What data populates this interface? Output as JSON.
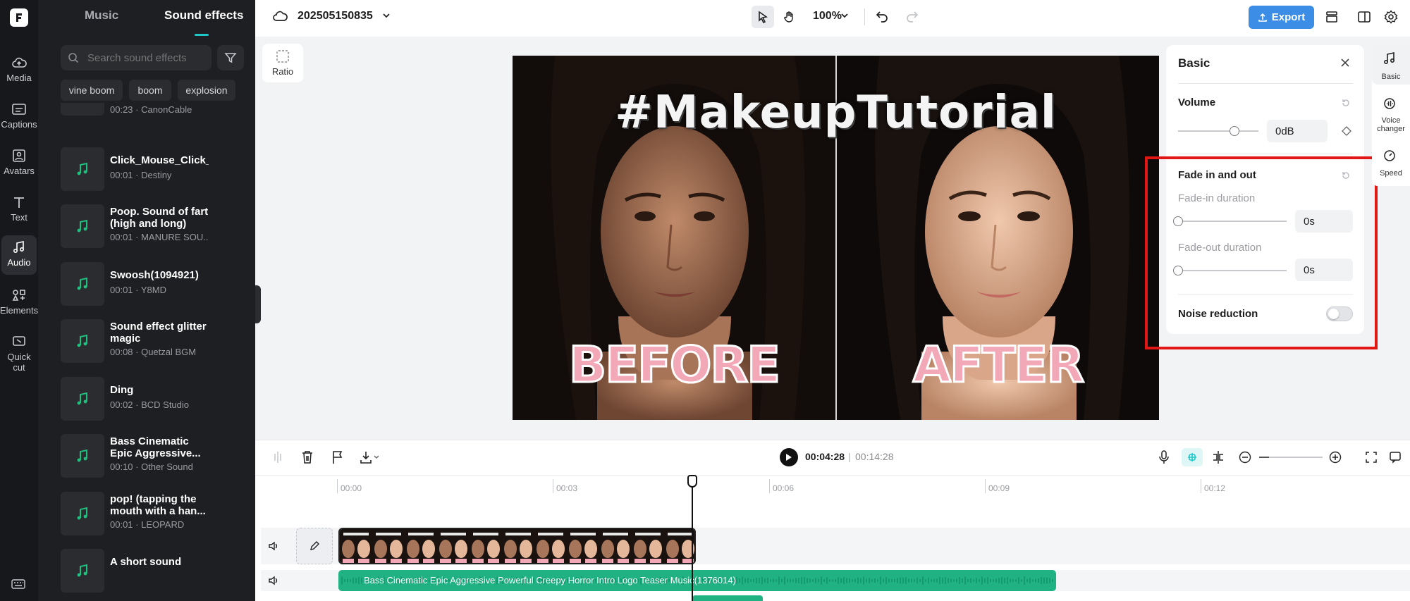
{
  "rail": {
    "items": [
      {
        "label": "Media",
        "icon": "cloud-icon"
      },
      {
        "label": "Captions",
        "icon": "captions-icon"
      },
      {
        "label": "Avatars",
        "icon": "avatar-icon"
      },
      {
        "label": "Text",
        "icon": "text-icon"
      },
      {
        "label": "Audio",
        "icon": "music-note-icon"
      },
      {
        "label": "Elements",
        "icon": "elements-icon"
      },
      {
        "label": "Quick cut",
        "icon": "quick-cut-icon"
      }
    ]
  },
  "library": {
    "tabs": {
      "music": "Music",
      "sound_effects": "Sound effects"
    },
    "search_placeholder": "Search sound effects",
    "chips": [
      "vine boom",
      "boom",
      "explosion"
    ],
    "partial_item_meta": "00:23 · CanonCable",
    "items": [
      {
        "title": "Click_Mouse_Click_",
        "meta": "00:01 · Destiny"
      },
      {
        "title": "Poop. Sound of fart (high and long)",
        "meta": "00:01 · MANURE SOU..."
      },
      {
        "title": "Swoosh(1094921)",
        "meta": "00:01 · Y8MD"
      },
      {
        "title": "Sound effect glitter magic",
        "meta": "00:08 · Quetzal BGM"
      },
      {
        "title": "Ding",
        "meta": "00:02 · BCD Studio"
      },
      {
        "title": "Bass Cinematic Epic Aggressive...",
        "meta": "00:10 · Other Sound"
      },
      {
        "title": "pop! (tapping the mouth with a han...",
        "meta": "00:01 · LEOPARD"
      },
      {
        "title": "A short sound",
        "meta": ""
      }
    ]
  },
  "topbar": {
    "project_name": "202505150835",
    "zoom": "100%",
    "export_label": "Export"
  },
  "canvas": {
    "ratio_label": "Ratio",
    "preview": {
      "hashtag": "#MakeupTutorial",
      "before": "BEFORE",
      "after": "AFTER"
    }
  },
  "panel": {
    "title": "Basic",
    "volume_label": "Volume",
    "volume_value": "0dB",
    "volume_level": 0.7,
    "fade_title": "Fade in and out",
    "fade_in_label": "Fade-in duration",
    "fade_in_value": "0s",
    "fade_out_label": "Fade-out duration",
    "fade_out_value": "0s",
    "noise_label": "Noise reduction",
    "noise_on": false
  },
  "side_tabs": [
    "Basic",
    "Voice changer",
    "Speed"
  ],
  "timeline": {
    "current_time": "00:04:28",
    "total_time": "00:14:28",
    "ruler": [
      "00:00",
      "00:03",
      "00:06",
      "00:09",
      "00:12"
    ],
    "audio_clip_label": "Bass Cinematic Epic Aggressive Powerful Creepy Horror Intro Logo Teaser Music(1376014)"
  },
  "colors": {
    "accent": "#1ec8c8",
    "export": "#3b8de6",
    "audio_clip": "#21b283",
    "highlight": "#e31616"
  }
}
